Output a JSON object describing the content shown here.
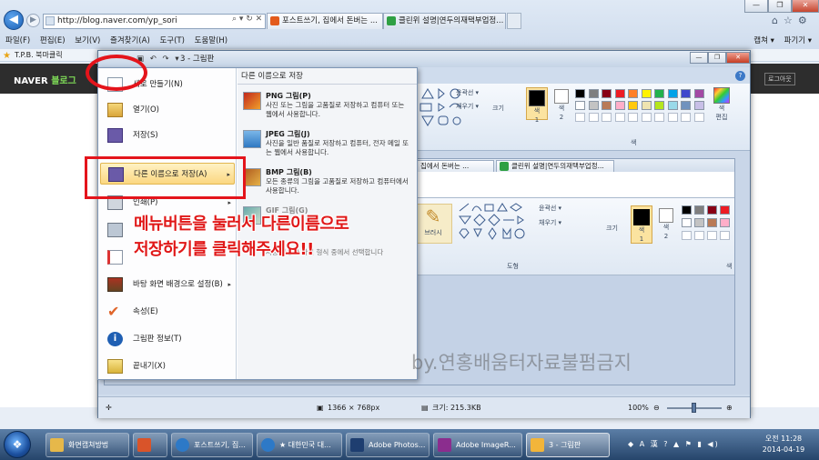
{
  "browser": {
    "address": "http://blog.naver.com/yp_sori",
    "tabs": [
      {
        "label": "포스트쓰기, 집에서 돈버는 ...",
        "favicon_color": "#e35b1c"
      },
      {
        "label": "클린위 설명|연두의재택부업정...",
        "favicon_color": "#2fa043"
      }
    ],
    "menu": [
      "파일(F)",
      "편집(E)",
      "보기(V)",
      "즐겨찾기(A)",
      "도구(T)",
      "도움말(H)"
    ],
    "toolbar_right": [
      "캡쳐 ▾",
      "파기기 ▾"
    ],
    "favorites": "T.P.B. 북마클릭"
  },
  "naver": {
    "logo": "NAVER",
    "logo_sub": "블로그",
    "login": "로그아웃"
  },
  "paint": {
    "title": "3 - 그림판",
    "menu_button": "▾",
    "ribbon": {
      "outline": "윤곽선 ▾",
      "fill": "채우기 ▾",
      "size": "크기",
      "color1": "색\n1",
      "color2": "색\n2",
      "colors_group": "색",
      "edit_colors": "색\n편집",
      "palette": [
        "#000000",
        "#7f7f7f",
        "#880015",
        "#ed1c24",
        "#ff7f27",
        "#fff200",
        "#22b14c",
        "#00a2e8",
        "#3f48cc",
        "#a349a4",
        "#ffffff",
        "#c3c3c3",
        "#b97a57",
        "#ffaec9",
        "#ffc90e",
        "#efe4b0",
        "#b5e61d",
        "#99d9ea",
        "#7092be",
        "#c8bfe7"
      ]
    },
    "inner": {
      "tab1": "집에서 돈버는 ...",
      "tab2": "클린위 설명|연두의재택부업정...",
      "brush": "브러시",
      "outline": "윤곽선 ▾",
      "fill": "채우기 ▾",
      "size": "크기",
      "color1": "색\n1",
      "color2": "색\n2",
      "shapes_label": "도형",
      "color_label": "색"
    },
    "status": {
      "position": "",
      "dimensions": "1366 × 768px",
      "size": "크기: 215.3KB",
      "zoom": "100%"
    }
  },
  "file_menu": {
    "left": [
      {
        "label": "새로 만들기(N)",
        "arrow": ""
      },
      {
        "label": "열기(O)",
        "arrow": ""
      },
      {
        "label": "저장(S)",
        "arrow": ""
      },
      {
        "label": "다른 이름으로 저장(A)",
        "arrow": "▸"
      },
      {
        "label": "인쇄(P)",
        "arrow": "▸"
      },
      {
        "label": "",
        "arrow": ""
      },
      {
        "label": "",
        "arrow": ""
      },
      {
        "label": "바탕 화면 배경으로 설정(B)",
        "arrow": "▸"
      },
      {
        "label": "속성(E)",
        "arrow": ""
      },
      {
        "label": "그림판 정보(T)",
        "arrow": ""
      },
      {
        "label": "끝내기(X)",
        "arrow": ""
      }
    ],
    "right_header": "다른 이름으로 저장",
    "right": [
      {
        "title": "PNG 그림(P)",
        "desc": "사진 또는 그림을 고품질로 저장하고 컴퓨터 또는 웹에서 사용합니다."
      },
      {
        "title": "JPEG 그림(J)",
        "desc": "사진을 일반 품질로 저장하고 컴퓨터, 전자 메일 또는 웹에서 사용합니다."
      },
      {
        "title": "BMP 그림(B)",
        "desc": "모든 종류의 그림을 고품질로 저장하고 컴퓨터에서 사용합니다."
      },
      {
        "title": "GIF 그림(G)",
        "desc": ""
      },
      {
        "title": "",
        "desc": "사용 가능한 파일 형식 중에서 선택합니다"
      }
    ]
  },
  "annotation": {
    "line1": "메뉴버튼을 눌러서 다른이름으로",
    "line2": "저장하기를 클릭해주세요!!",
    "watermark": "by.연홍배움터자료불펌금지"
  },
  "taskbar": {
    "items": [
      {
        "label": "화면캡쳐방법",
        "color": "#e6b84a"
      },
      {
        "label": "",
        "color": "#d9542a"
      },
      {
        "label": "포스트쓰기, 집...",
        "color": "#2d79c7"
      },
      {
        "label": "★ 대한민국 대...",
        "color": "#2d79c7"
      },
      {
        "label": "Adobe Photos...",
        "color": "#1e3e70"
      },
      {
        "label": "Adobe ImageR...",
        "color": "#8b2d8e"
      },
      {
        "label": "3 - 그림판",
        "color": "#f2b53a"
      }
    ],
    "tray": "A 漢 ?",
    "time": "오전 11:28",
    "date": "2014-04-19"
  }
}
